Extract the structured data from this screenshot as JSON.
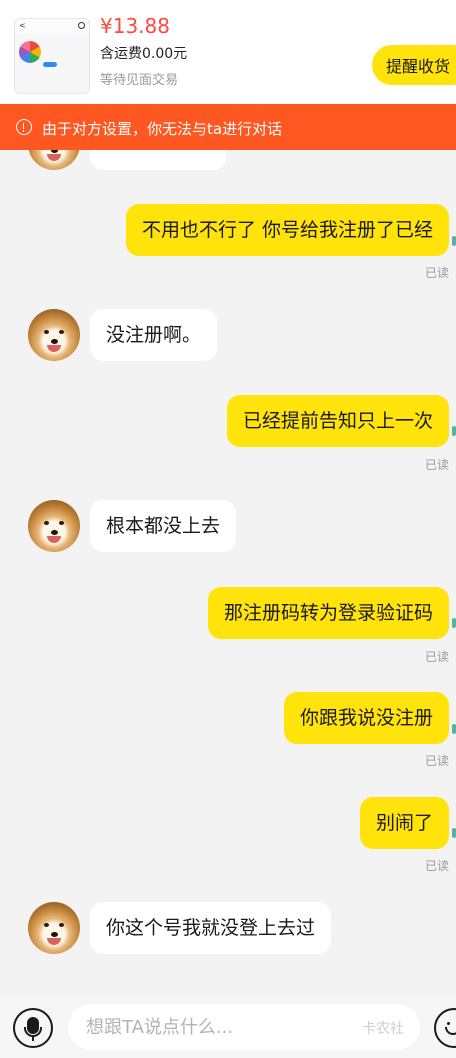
{
  "product": {
    "price": "¥13.88",
    "shipping": "含运费0.00元",
    "status": "等待见面交易",
    "remind_button": "提醒收货"
  },
  "banner": {
    "text": "由于对方设置，你无法与ta进行对话",
    "icon": "warning-circle-icon",
    "color": "#ff5722"
  },
  "messages": [
    {
      "side": "out",
      "text": "不用也不行了 你号给我注册了已经",
      "read": "已读"
    },
    {
      "side": "in",
      "text": "没注册啊。"
    },
    {
      "side": "out",
      "text": "已经提前告知只上一次",
      "read": "已读"
    },
    {
      "side": "in",
      "text": "根本都没上去"
    },
    {
      "side": "out",
      "text": "那注册码转为登录验证码",
      "read": "已读"
    },
    {
      "side": "out",
      "text": "你跟我说没注册",
      "read": "已读"
    },
    {
      "side": "out",
      "text": "别闹了",
      "read": "已读"
    },
    {
      "side": "in",
      "text": "你这个号我就没登上去过"
    }
  ],
  "input_bar": {
    "placeholder": "想跟TA说点什么...",
    "voice_icon": "microphone-icon",
    "emoji_icon": "emoji-icon",
    "watermark": "卡农社"
  },
  "colors": {
    "outgoing_bubble": "#ffe30a",
    "incoming_bubble": "#ffffff",
    "price": "#ff4a3d",
    "background": "#f3f3f3"
  }
}
